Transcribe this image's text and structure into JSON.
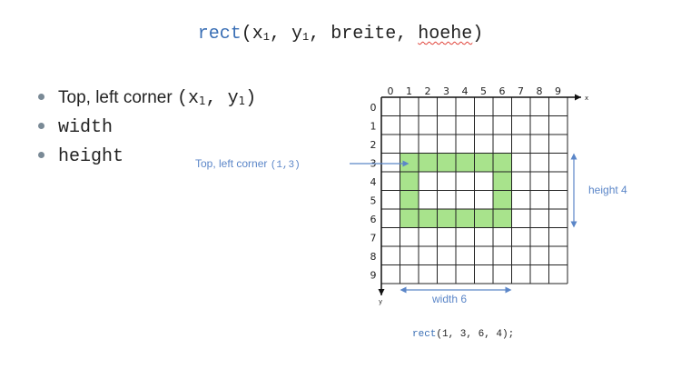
{
  "title": {
    "func": "rect",
    "open": "(",
    "x": "x",
    "y": "y",
    "sub1": "1",
    "sep": ", ",
    "breite": "breite",
    "hoehe": "hoehe",
    "close": ")"
  },
  "bullets": {
    "corner_text": "Top, left corner ",
    "corner_code_open": "(x",
    "corner_code_mid": ", y",
    "corner_code_close": ")",
    "sub1": "1",
    "width": "width",
    "height": "height"
  },
  "grid": {
    "columns": [
      "0",
      "1",
      "2",
      "3",
      "4",
      "5",
      "6",
      "7",
      "8",
      "9"
    ],
    "rows": [
      "0",
      "1",
      "2",
      "3",
      "4",
      "5",
      "6",
      "7",
      "8",
      "9"
    ],
    "x_axis_label": "x",
    "y_axis_label": "y",
    "filled_rect": {
      "x": 1,
      "y": 3,
      "width": 6,
      "height": 4
    },
    "fill_color": "#a8e38c",
    "line_color": "#222222"
  },
  "annotations": {
    "corner_label": "Top, left corner ",
    "corner_coords": "(1,3)",
    "height_label": "height 4",
    "width_label": "width 6",
    "color": "#5b86c8"
  },
  "code": {
    "func": "rect",
    "args": "(1, 3, 6, 4);"
  }
}
